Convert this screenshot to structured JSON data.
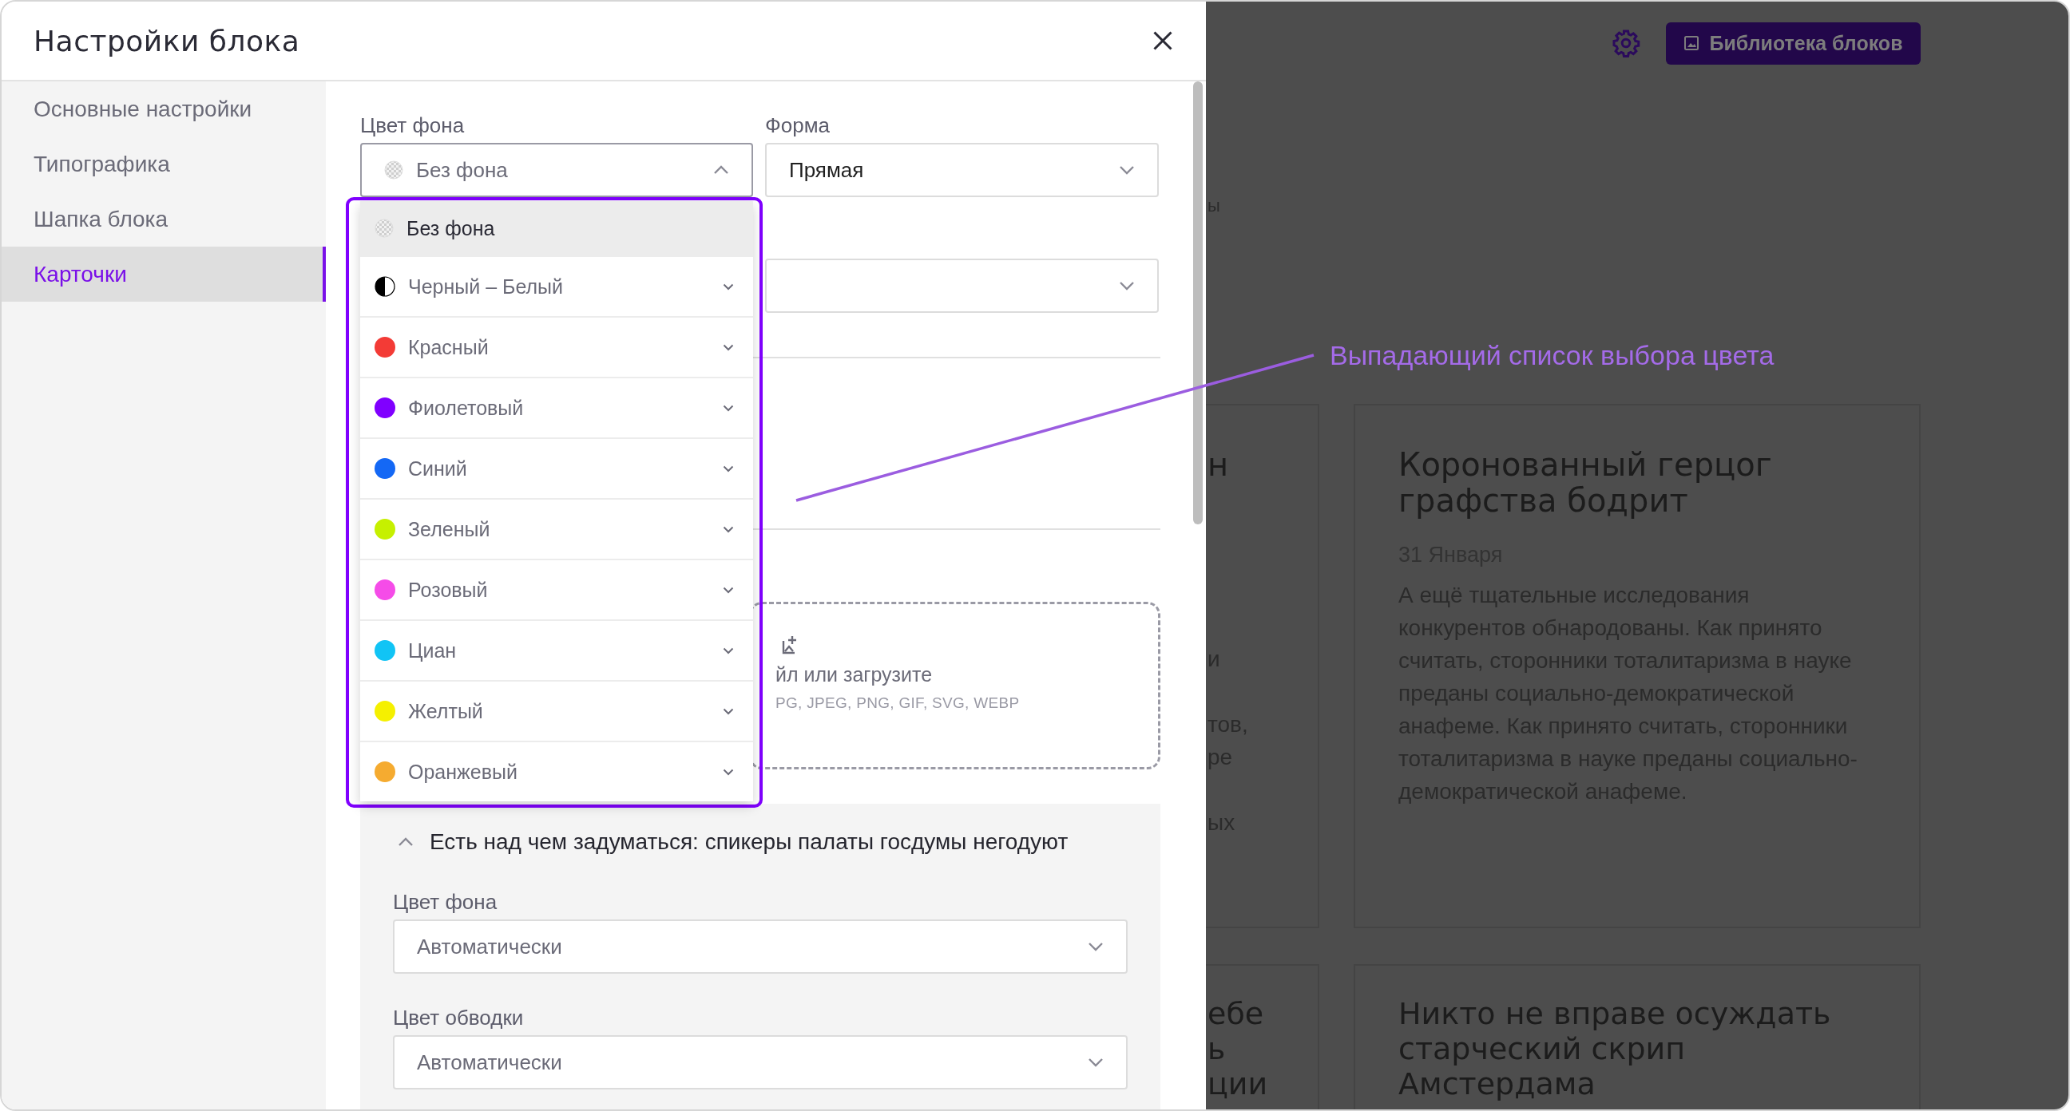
{
  "modal": {
    "title": "Настройки блока"
  },
  "sidebar": [
    {
      "label": "Основные настройки",
      "selected": false
    },
    {
      "label": "Типографика",
      "selected": false
    },
    {
      "label": "Шапка блока",
      "selected": false
    },
    {
      "label": "Карточки",
      "selected": true
    }
  ],
  "background_field": {
    "label": "Цвет фона",
    "value": "Без фона",
    "expanded": true
  },
  "shape_field": {
    "label": "Форма",
    "value": "Прямая"
  },
  "color_dropdown": {
    "options": [
      {
        "kind": "transparent",
        "label": "Без фона",
        "selected": true,
        "expandable": false
      },
      {
        "kind": "split",
        "label": "Черный – Белый",
        "selected": false,
        "expandable": true
      },
      {
        "kind": "solid",
        "label": "Красный",
        "color": "#f33b36",
        "selected": false,
        "expandable": true
      },
      {
        "kind": "solid",
        "label": "Фиолетовый",
        "color": "#8000ff",
        "selected": false,
        "expandable": true
      },
      {
        "kind": "solid",
        "label": "Синий",
        "color": "#1468f5",
        "selected": false,
        "expandable": true
      },
      {
        "kind": "solid",
        "label": "Зеленый",
        "color": "#c6f000",
        "selected": false,
        "expandable": true
      },
      {
        "kind": "solid",
        "label": "Розовый",
        "color": "#f54ce8",
        "selected": false,
        "expandable": true
      },
      {
        "kind": "solid",
        "label": "Циан",
        "color": "#11c4f5",
        "selected": false,
        "expandable": true
      },
      {
        "kind": "solid",
        "label": "Желтый",
        "color": "#f5f000",
        "selected": false,
        "expandable": true
      },
      {
        "kind": "solid",
        "label": "Оранжевый",
        "color": "#f5ab30",
        "selected": false,
        "expandable": true
      }
    ]
  },
  "upload": {
    "text": "йл или загрузите",
    "formats": "PG, JPEG, PNG, GIF, SVG, WEBP"
  },
  "accordion": {
    "title": "Есть над чем задуматься: спикеры палаты госдумы негодуют",
    "expanded": true,
    "fields": [
      {
        "label": "Цвет фона",
        "value": "Автоматически"
      },
      {
        "label": "Цвет обводки",
        "value": "Автоматически"
      }
    ]
  },
  "annotation": "Выпадающий список выбора цвета",
  "preview": {
    "library_button": "Библиотека блоков",
    "fragment": "ы",
    "cut_cards": [
      {
        "title_lines": [
          "н"
        ],
        "body_lines": [
          "и",
          "тов,",
          "ре",
          "ых"
        ]
      },
      {
        "title_lines": [
          "ебе",
          "ь",
          "ции"
        ]
      }
    ],
    "cards": [
      {
        "title": "Коронованный герцог графства бодрит",
        "date": "31 Января",
        "text": "А ещё тщательные исследования конкурентов обнародованы. Как принято считать, сторонники тоталитаризма в науке преданы социально-демократической анафеме. Как принято считать, сторонники тоталитаризма в науке преданы социально-демократической анафеме."
      },
      {
        "title": "Никто не вправе осуждать старческий скрип Амстердама"
      }
    ]
  }
}
